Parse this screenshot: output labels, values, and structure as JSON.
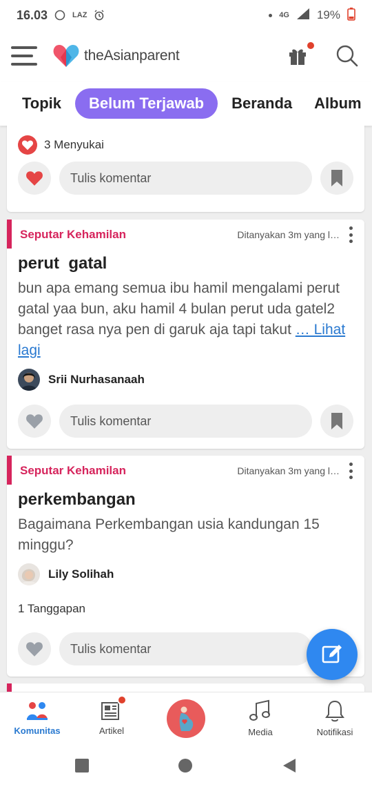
{
  "status_bar": {
    "time": "16.03",
    "network": "4G",
    "battery": "19%"
  },
  "app": {
    "logo_text": "theAsianparent"
  },
  "tabs": [
    {
      "label": "Topik",
      "active": false
    },
    {
      "label": "Belum Terjawab",
      "active": true
    },
    {
      "label": "Beranda",
      "active": false
    },
    {
      "label": "Album",
      "active": false
    }
  ],
  "feed": {
    "partial_card": {
      "likes": "3 Menyukai",
      "comment_placeholder": "Tulis komentar"
    },
    "posts": [
      {
        "category": "Seputar Kehamilan",
        "asked": "Ditanyakan 3m yang l…",
        "title": "perut  gatal",
        "body": "bun apa emang semua ibu hamil mengalami perut gatal yaa bun, aku hamil 4 bulan perut uda gatel2 banget rasa nya pen di garuk aja tapi takut",
        "more": "… Lihat lagi",
        "author": "Srii Nurhasanaah",
        "comment_placeholder": "Tulis komentar"
      },
      {
        "category": "Seputar Kehamilan",
        "asked": "Ditanyakan 3m yang l…",
        "title": "perkembangan",
        "body": "Bagaimana Perkembangan usia kandungan 15 minggu?",
        "author": "Lily Solihah",
        "responses": "1 Tanggapan",
        "comment_placeholder": "Tulis komentar"
      }
    ]
  },
  "bottom_nav": [
    {
      "label": "Komunitas",
      "icon": "community-icon",
      "active": true
    },
    {
      "label": "Artikel",
      "icon": "article-icon",
      "active": false
    },
    {
      "label": "",
      "icon": "pregnancy-icon",
      "active": false
    },
    {
      "label": "Media",
      "icon": "music-note-icon",
      "active": false
    },
    {
      "label": "Notifikasi",
      "icon": "bell-icon",
      "active": false
    }
  ],
  "colors": {
    "accent_purple": "#8a6df0",
    "category_pink": "#d6245c",
    "link_blue": "#2979d0",
    "fab_blue": "#2f88f0",
    "heart_red": "#e54545"
  }
}
